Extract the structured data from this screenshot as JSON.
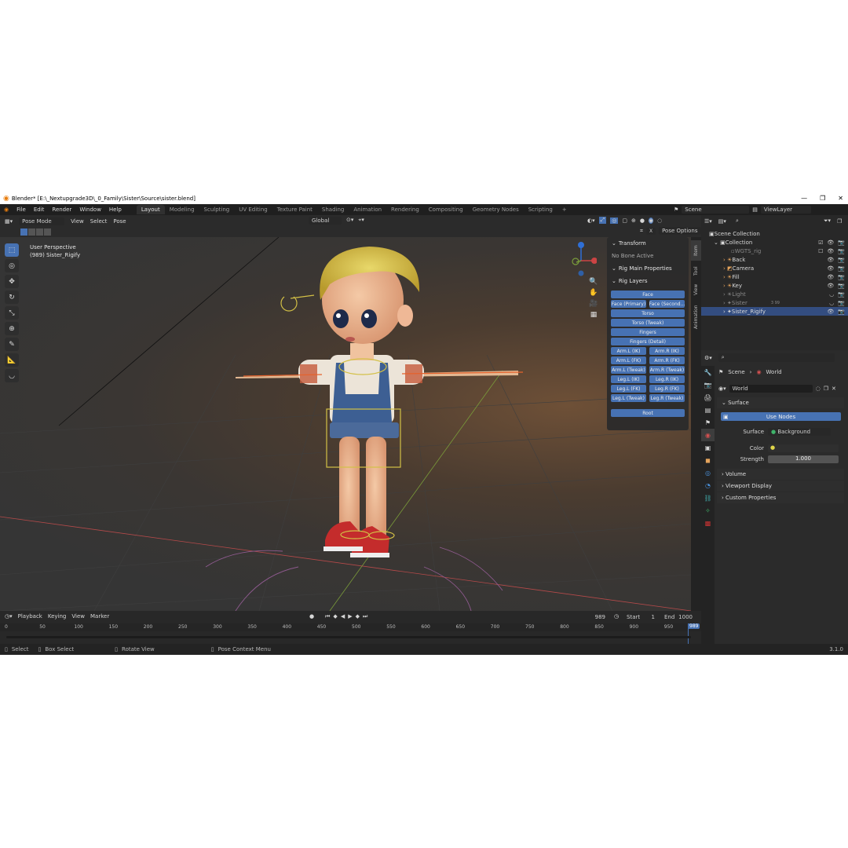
{
  "title": "Blender* [E:\\_Nextupgrade3D\\_0_Family\\Sister\\Source\\sister.blend]",
  "menu": [
    "File",
    "Edit",
    "Render",
    "Window",
    "Help"
  ],
  "workspaces": [
    "Layout",
    "Modeling",
    "Sculpting",
    "UV Editing",
    "Texture Paint",
    "Shading",
    "Animation",
    "Rendering",
    "Compositing",
    "Geometry Nodes",
    "Scripting"
  ],
  "active_workspace": "Layout",
  "scene_name": "Scene",
  "view_layer": "ViewLayer",
  "viewport_header": {
    "mode": "Pose Mode",
    "menus": [
      "View",
      "Select",
      "Pose"
    ],
    "orientation": "Global",
    "options": "Pose Options"
  },
  "viewport_info": {
    "line1": "User Perspective",
    "line2": "(989) Sister_Rigify"
  },
  "npanel": {
    "transform": "Transform",
    "no_bone": "No Bone Active",
    "rig_main": "Rig Main Properties",
    "rig_layers": "Rig Layers",
    "face": "Face",
    "rows": [
      [
        "Face (Primary)",
        "Face (Second..."
      ],
      [
        "Torso"
      ],
      [
        "Torso (Tweak)"
      ],
      [
        "Fingers"
      ],
      [
        "Fingers (Detail)"
      ],
      [
        "Arm.L (IK)",
        "Arm.R (IK)"
      ],
      [
        "Arm.L (FK)",
        "Arm.R (FK)"
      ],
      [
        "Arm.L (Tweak)",
        "Arm.R (Tweak)"
      ],
      [
        "Leg.L (IK)",
        "Leg.R (IK)"
      ],
      [
        "Leg.L (FK)",
        "Leg.R (FK)"
      ],
      [
        "Leg.L (Tweak)",
        "Leg.R (Tweak)"
      ]
    ],
    "root": "Root"
  },
  "side_tabs": [
    "Item",
    "Tool",
    "View",
    "Animation"
  ],
  "outliner": {
    "scene_collection": "Scene Collection",
    "collection": "Collection",
    "items": [
      "WGTS_rig",
      "Back",
      "Camera",
      "Fill",
      "Key",
      "Light",
      "Sister",
      "Sister_Rigify"
    ],
    "sister_badge": "3 99"
  },
  "properties": {
    "breadcrumb_scene": "Scene",
    "breadcrumb_world": "World",
    "world_name": "World",
    "surface_header": "Surface",
    "use_nodes": "Use Nodes",
    "surface_label": "Surface",
    "surface_value": "Background",
    "color_label": "Color",
    "strength_label": "Strength",
    "strength_value": "1.000",
    "sections": [
      "Volume",
      "Viewport Display",
      "Custom Properties"
    ]
  },
  "timeline": {
    "menus": [
      "Playback",
      "Keying",
      "View",
      "Marker"
    ],
    "current_frame": "989",
    "start_label": "Start",
    "start": "1",
    "end_label": "End",
    "end": "1000",
    "ticks": [
      "0",
      "50",
      "100",
      "150",
      "200",
      "250",
      "300",
      "350",
      "400",
      "450",
      "500",
      "550",
      "600",
      "650",
      "700",
      "750",
      "800",
      "850",
      "900",
      "950"
    ],
    "playhead": "989"
  },
  "statusbar": {
    "select": "Select",
    "box_select": "Box Select",
    "rotate": "Rotate View",
    "context": "Pose Context Menu",
    "version": "3.1.0"
  },
  "colors": {
    "accent": "#4772b3",
    "selected_row": "#334d80",
    "x_axis": "#b54a4a",
    "y_axis": "#7a9c3a"
  }
}
